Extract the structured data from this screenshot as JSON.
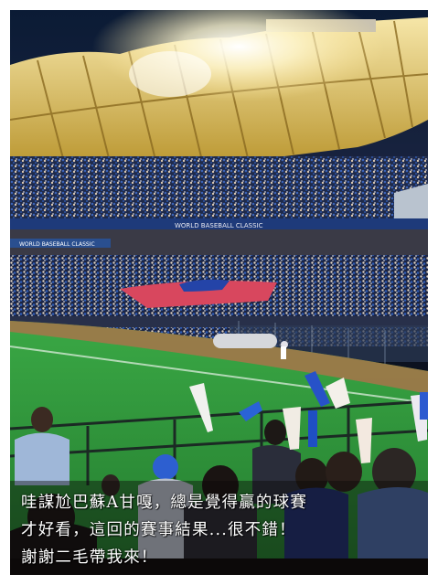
{
  "photo": {
    "subject": "baseball stadium at night with crowd and large flag"
  },
  "caption": {
    "lines": [
      "哇謀尬巴蘇A甘嘎，總是覺得贏的球賽",
      "才好看，這回的賽事結果...很不錯！",
      "謝謝二毛帶我來！"
    ]
  },
  "signage": {
    "upper_banner": "WORLD BASEBALL CLASSIC",
    "lower_banner": "WORLD BASEBALL CLASSIC"
  },
  "colors": {
    "field": "#2f9a3c",
    "crowd_blue": "#2b4f9a",
    "flag_red": "#d8475e",
    "flag_blue": "#2444a8"
  }
}
